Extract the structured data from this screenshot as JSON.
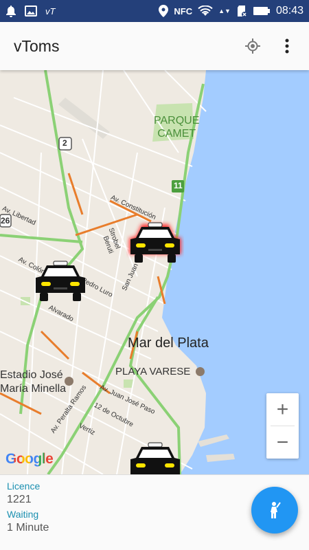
{
  "status_bar": {
    "time": "08:43",
    "nfc_label": "NFC",
    "app_badge": "vT",
    "icons": [
      "notification-bell-icon",
      "image-icon",
      "location-pin-icon",
      "nfc-icon",
      "wifi-icon",
      "sd-card-icon",
      "battery-icon"
    ]
  },
  "app_bar": {
    "title": "vToms",
    "actions": [
      "my-location-icon",
      "overflow-menu-icon"
    ]
  },
  "map": {
    "labels": {
      "parque_camet": "PARQUE\nCAMET",
      "route_2": "2",
      "route_11": "11",
      "route_226": "26",
      "av_libertad": "Av. Libertad",
      "av_constitucion": "Av. Constitución",
      "av_colon": "Av. Colón",
      "pedro_luro": "Pedro Luro",
      "alvarado": "Alvarado",
      "strobel": "Strobel",
      "beruti": "Beruti",
      "san_juan": "San Juan",
      "mar_del_plata": "Mar del Plata",
      "playa_varese": "PLAYA VARESE",
      "estadio": "Estadio José\nMaría Minella",
      "av_juan_jose_paso": "Av. Juan José Paso",
      "doce_octubre": "12 de Octubre",
      "vertiz": "Vertiz",
      "av_peralta_ramos": "Av. Peralta Ramos"
    },
    "google_logo": "Google",
    "zoom_in": "+",
    "zoom_out": "−",
    "colors": {
      "water": "#a3ccff",
      "land": "#efeae2",
      "road": "#ffffff",
      "highway": "#8bd175",
      "traffic": "#e87d2c",
      "park": "#c8e3b0"
    }
  },
  "panel": {
    "licence_label": "Licence",
    "licence_value": "1221",
    "waiting_label": "Waiting",
    "waiting_value": "1 Minute",
    "fab_icon": "hail-person-icon"
  }
}
